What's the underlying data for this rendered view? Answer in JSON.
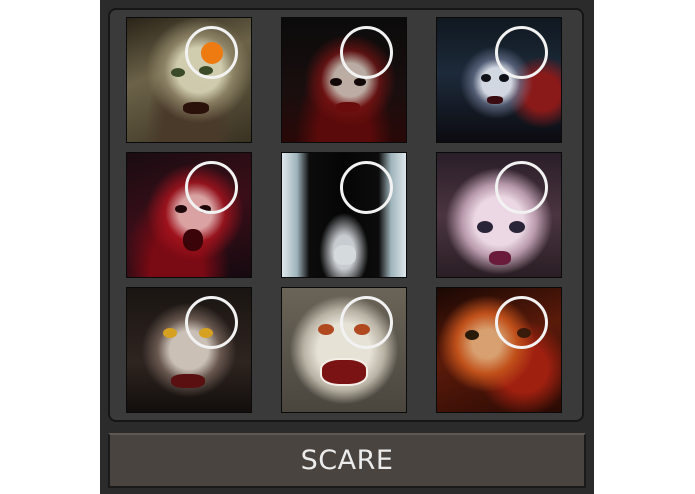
{
  "scare_button": {
    "label": "SCARE"
  },
  "tiles": [
    {
      "name": "scary-face-girl-green-eyes",
      "selected": true
    },
    {
      "name": "scary-face-zombie-child",
      "selected": false
    },
    {
      "name": "scary-face-pale-ghost-woman",
      "selected": false
    },
    {
      "name": "scary-face-bloody-screaming-woman",
      "selected": false
    },
    {
      "name": "scary-face-long-hair-ghost",
      "selected": false
    },
    {
      "name": "scary-face-white-demon-child",
      "selected": false
    },
    {
      "name": "scary-face-vampire-yellow-eyes",
      "selected": false
    },
    {
      "name": "scary-face-vampire-fangs-woman",
      "selected": false
    },
    {
      "name": "scary-face-burned-red-face",
      "selected": false
    }
  ],
  "colors": {
    "panel_bg": "#2b2b2b",
    "grid_bg": "#3a3a3a",
    "selector_ring": "#f2f2f2",
    "selected_dot": "#ee7a12",
    "button_bg": "#4a4440"
  }
}
